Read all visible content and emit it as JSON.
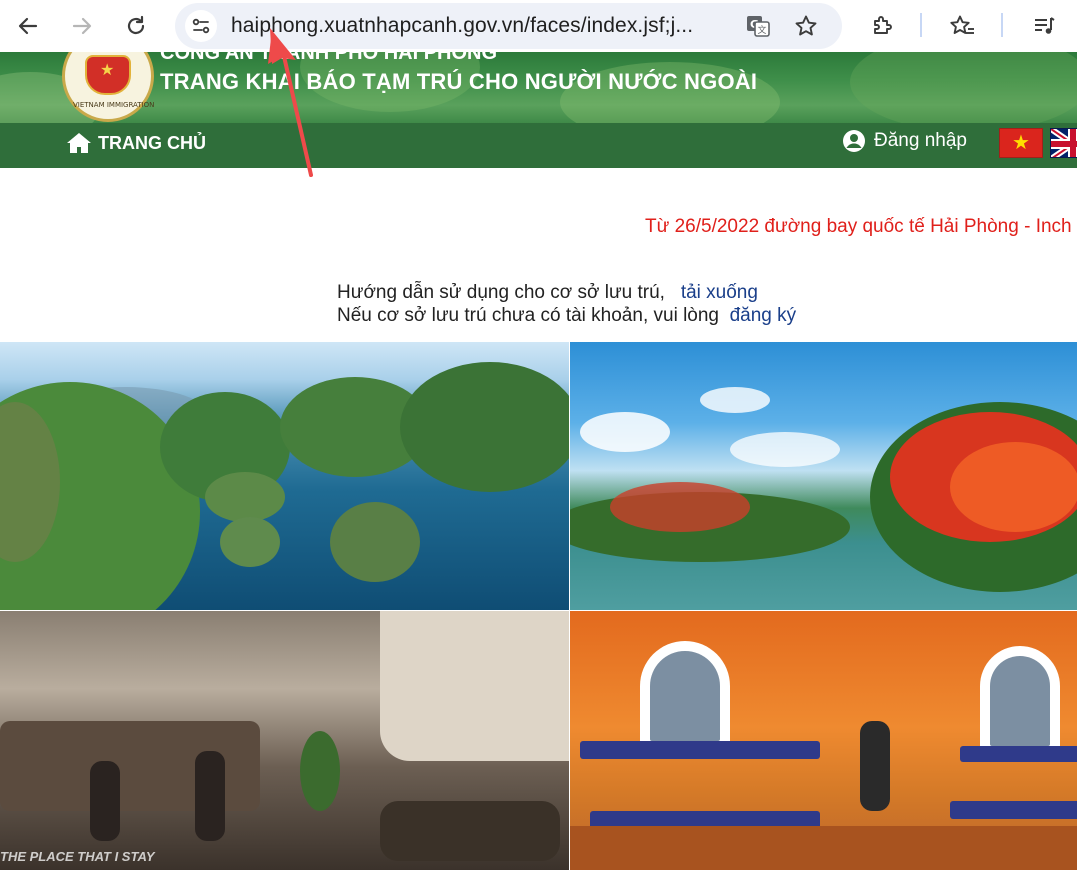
{
  "browser": {
    "url": "haiphong.xuatnhapcanh.gov.vn/faces/index.jsf;j...",
    "buttons": [
      {
        "name": "back-button",
        "icon": "arrow-left-icon"
      },
      {
        "name": "forward-button",
        "icon": "arrow-right-icon"
      },
      {
        "name": "reload-button",
        "icon": "reload-icon"
      }
    ],
    "omnibox_icons": [
      "site-info-icon",
      "translate-icon",
      "bookmark-star-icon"
    ],
    "toolbar_icons": [
      "extensions-icon",
      "favorites-icon",
      "media-queue-icon"
    ]
  },
  "header": {
    "top_text": "CÔNG AN THÀNH PHỐ HẢI PHÒNG",
    "title": "TRANG KHAI BÁO TẠM TRÚ CHO NGƯỜI NƯỚC NGOÀI",
    "emblem_text": "VIETNAM IMMIGRATION"
  },
  "nav": {
    "home_label": "TRANG CHỦ",
    "login_label": "Đăng nhập",
    "languages": [
      "vietnamese-flag",
      "english-flag"
    ]
  },
  "announcement": "Từ 26/5/2022 đường bay quốc tế Hải Phòng - Inch",
  "guide": {
    "line1": "Hướng dẫn sử dụng cho cơ sở lưu trú,",
    "line1_link": "tải xuống",
    "line2": "Nếu cơ sở lưu trú chưa có tài khoản, vui lòng",
    "line2_link": "đăng ký"
  },
  "photos": {
    "lobby_watermark": "THE PLACE THAT I STAY"
  },
  "colors": {
    "header_green": "#3f8f4a",
    "nav_green": "#2f6e3a",
    "announcement_red": "#e0201b",
    "link_blue": "#1a3f8a",
    "annotation_red": "#ee4a4a"
  }
}
